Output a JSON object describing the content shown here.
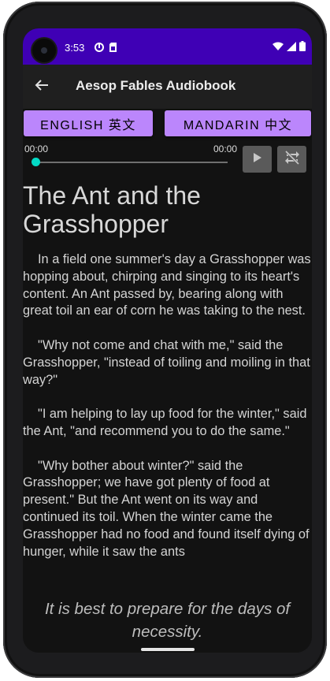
{
  "status_bar": {
    "time": "3:53",
    "colors": {
      "background": "#3f00b5"
    }
  },
  "app_bar": {
    "title": "Aesop Fables Audiobook",
    "back_icon": "arrow-back-icon"
  },
  "language_buttons": {
    "english_label": "ENGLISH 英文",
    "mandarin_label": "MANDARIN 中文"
  },
  "player": {
    "current_time": "00:00",
    "total_time": "00:00",
    "progress": 0.0,
    "play_icon": "play-icon",
    "loop_icon": "repeat-off-icon"
  },
  "story": {
    "title": "The Ant and the Grasshopper",
    "paragraphs": [
      "In a field one summer's day a Grasshopper was hopping about, chirping and singing to its heart's content.  An Ant passed by, bearing along with great toil an ear of corn he was taking to the nest.",
      "\"Why not come and chat with me,\" said the Grasshopper, \"instead of toiling and moiling in that way?\"",
      "\"I am helping to lay up food for the winter,\" said the Ant, \"and recommend you to do the same.\"",
      "\"Why bother about winter?\" said the Grasshopper; we have got plenty of food at present.\"  But the Ant went on its way and continued its toil.  When the winter came the Grasshopper had no food and found itself dying of hunger, while it saw the ants"
    ],
    "moral": "It is best to prepare for the days of necessity."
  },
  "colors": {
    "accent": "#bb86fc",
    "seek": "#03dac5",
    "background": "#121212",
    "app_bar": "#1f1f1f"
  }
}
